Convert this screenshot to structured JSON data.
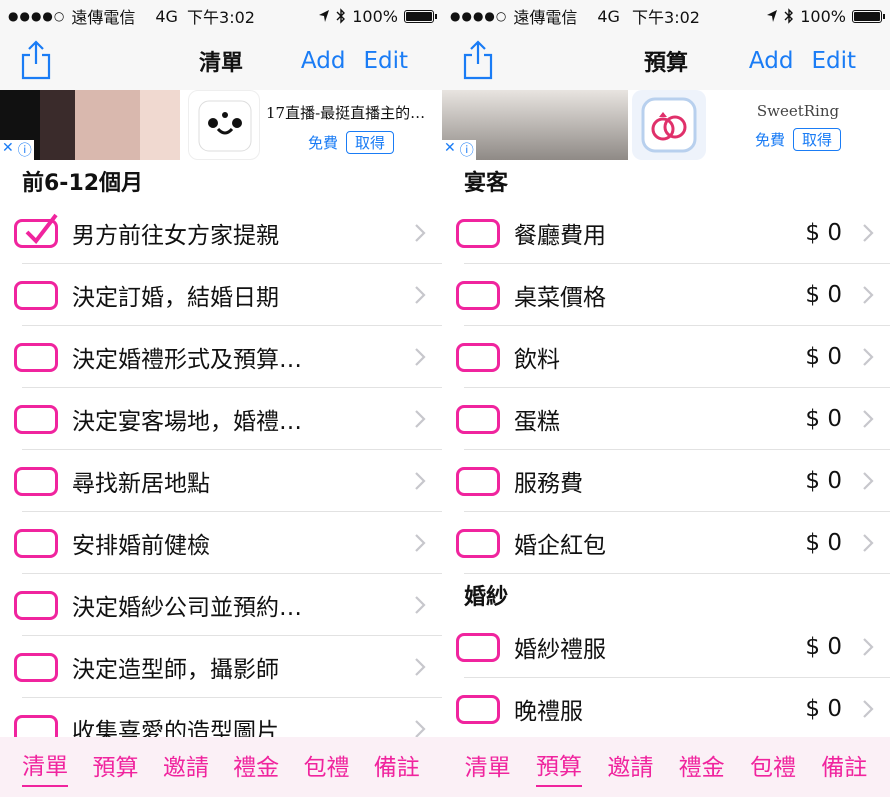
{
  "status": {
    "signal": "●●●●○",
    "carrier": "遠傳電信",
    "network": "4G",
    "time": "下午3:02",
    "battery": "100%",
    "battery_level": 1.0
  },
  "left": {
    "nav": {
      "title": "清單",
      "add": "Add",
      "edit": "Edit"
    },
    "ad": {
      "title": "17直播-最挺直播主的…",
      "free": "免費",
      "get": "取得"
    },
    "section": "前6-12個月",
    "rows": [
      {
        "label": "男方前往女方家提親",
        "checked": true
      },
      {
        "label": "決定訂婚，結婚日期",
        "checked": false
      },
      {
        "label": "決定婚禮形式及預算…",
        "checked": false
      },
      {
        "label": "決定宴客場地，婚禮…",
        "checked": false
      },
      {
        "label": "尋找新居地點",
        "checked": false
      },
      {
        "label": "安排婚前健檢",
        "checked": false
      },
      {
        "label": "決定婚紗公司並預約…",
        "checked": false
      },
      {
        "label": "決定造型師，攝影師",
        "checked": false
      },
      {
        "label": "收集喜愛的造型圖片",
        "checked": false
      }
    ]
  },
  "right": {
    "nav": {
      "title": "預算",
      "add": "Add",
      "edit": "Edit"
    },
    "ad": {
      "title": "SweetRing",
      "free": "免費",
      "get": "取得"
    },
    "sections": [
      {
        "header": "宴客",
        "rows": [
          {
            "label": "餐廳費用",
            "amount": "$ 0"
          },
          {
            "label": "桌菜價格",
            "amount": "$ 0"
          },
          {
            "label": "飲料",
            "amount": "$ 0"
          },
          {
            "label": "蛋糕",
            "amount": "$ 0"
          },
          {
            "label": "服務費",
            "amount": "$ 0"
          },
          {
            "label": "婚企紅包",
            "amount": "$ 0"
          }
        ]
      },
      {
        "header": "婚紗",
        "rows": [
          {
            "label": "婚紗禮服",
            "amount": "$ 0"
          },
          {
            "label": "晚禮服",
            "amount": "$ 0"
          }
        ]
      }
    ]
  },
  "tabs": [
    "清單",
    "預算",
    "邀請",
    "禮金",
    "包禮",
    "備註"
  ],
  "left_active_tab": 0,
  "right_active_tab": 1,
  "colors": {
    "accent": "#f0249e",
    "link": "#1a7cf5",
    "tabbar_bg": "#fbf0f6"
  }
}
